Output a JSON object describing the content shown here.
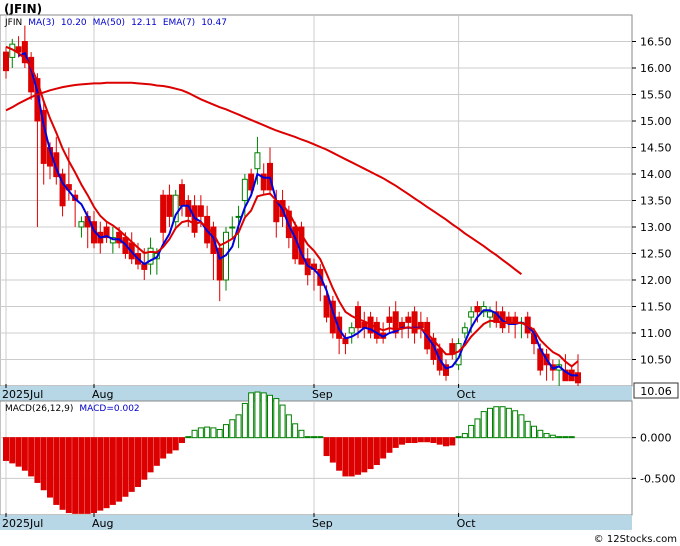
{
  "title": "(JFIN)",
  "watermark": "© 12Stocks.com",
  "price_panel": {
    "legend": [
      {
        "text": "JFIN",
        "color": "#000000"
      },
      {
        "text": "MA(3)",
        "color": "#0000cc"
      },
      {
        "text": "10.20",
        "color": "#0000cc"
      },
      {
        "text": "MA(50)",
        "color": "#0000cc"
      },
      {
        "text": "12.11",
        "color": "#0000cc"
      },
      {
        "text": "EMA(7)",
        "color": "#0000cc"
      },
      {
        "text": "10.47",
        "color": "#0000cc"
      }
    ],
    "last_price_label": "10.06"
  },
  "macd_panel": {
    "legend": [
      {
        "text": "MACD(26,12,9)",
        "color": "#000000"
      },
      {
        "text": "MACD=0.002",
        "color": "#0000cc"
      }
    ]
  },
  "colors": {
    "up": "#008000",
    "down": "#dd0000",
    "ma3": "#0000dd",
    "ma50": "#dd0000",
    "ema7": "#dd0000",
    "axis_strip": "#b7d7e6",
    "grid": "#cccccc"
  },
  "chart_data": [
    {
      "type": "candlestick",
      "title": "(JFIN)",
      "x_labels": [
        {
          "index": 0,
          "text": "2025Jul"
        },
        {
          "index": 14,
          "text": "Aug"
        },
        {
          "index": 49,
          "text": "Sep"
        },
        {
          "index": 72,
          "text": "Oct"
        }
      ],
      "yticks": [
        "16.50",
        "16.00",
        "15.50",
        "15.00",
        "14.50",
        "14.00",
        "13.50",
        "13.00",
        "12.50",
        "12.00",
        "11.50",
        "11.00",
        "10.50"
      ],
      "ylim": [
        10.0,
        17.0
      ],
      "ohlc": [
        [
          16.3,
          16.4,
          15.8,
          15.95
        ],
        [
          16.2,
          16.55,
          16.0,
          16.45
        ],
        [
          16.4,
          16.6,
          16.2,
          16.3
        ],
        [
          16.5,
          16.8,
          16.0,
          16.1
        ],
        [
          16.2,
          16.3,
          15.4,
          15.55
        ],
        [
          15.8,
          15.9,
          13.0,
          15.0
        ],
        [
          15.2,
          15.4,
          13.8,
          14.2
        ],
        [
          14.5,
          14.6,
          13.9,
          14.15
        ],
        [
          14.4,
          14.7,
          13.8,
          13.95
        ],
        [
          14.0,
          14.1,
          13.2,
          13.4
        ],
        [
          13.8,
          14.5,
          13.5,
          13.7
        ],
        [
          13.6,
          13.7,
          13.0,
          13.5
        ],
        [
          13.0,
          13.2,
          12.8,
          13.1
        ],
        [
          13.2,
          13.3,
          12.6,
          13.0
        ],
        [
          13.1,
          13.3,
          12.6,
          12.7
        ],
        [
          12.9,
          13.1,
          12.5,
          12.7
        ],
        [
          13.0,
          13.1,
          12.7,
          12.8
        ],
        [
          12.7,
          13.0,
          12.5,
          12.8
        ],
        [
          12.9,
          13.0,
          12.6,
          12.7
        ],
        [
          12.8,
          12.9,
          12.4,
          12.5
        ],
        [
          12.7,
          12.9,
          12.3,
          12.4
        ],
        [
          12.5,
          12.7,
          12.2,
          12.3
        ],
        [
          12.3,
          12.6,
          12.0,
          12.2
        ],
        [
          12.3,
          12.8,
          12.1,
          12.6
        ],
        [
          12.4,
          12.6,
          12.1,
          12.5
        ],
        [
          13.6,
          13.7,
          12.7,
          12.9
        ],
        [
          13.6,
          13.8,
          13.0,
          13.2
        ],
        [
          13.1,
          13.7,
          13.0,
          13.6
        ],
        [
          13.8,
          13.9,
          13.2,
          13.4
        ],
        [
          13.5,
          13.6,
          13.0,
          13.2
        ],
        [
          13.4,
          13.6,
          12.8,
          12.9
        ],
        [
          13.4,
          13.6,
          13.0,
          13.2
        ],
        [
          13.2,
          13.4,
          12.6,
          12.7
        ],
        [
          13.0,
          13.1,
          12.0,
          12.5
        ],
        [
          12.6,
          12.7,
          11.6,
          12.0
        ],
        [
          12.0,
          13.0,
          11.8,
          12.9
        ],
        [
          13.0,
          13.2,
          12.8,
          13.0
        ],
        [
          13.2,
          13.4,
          12.6,
          13.2
        ],
        [
          13.5,
          14.0,
          13.2,
          13.9
        ],
        [
          14.0,
          14.1,
          13.6,
          13.7
        ],
        [
          14.1,
          14.7,
          13.8,
          14.4
        ],
        [
          14.0,
          14.2,
          13.6,
          13.7
        ],
        [
          14.2,
          14.5,
          13.6,
          13.7
        ],
        [
          13.5,
          13.7,
          12.8,
          13.1
        ],
        [
          13.5,
          13.7,
          13.0,
          13.2
        ],
        [
          13.3,
          13.4,
          12.6,
          12.8
        ],
        [
          13.0,
          13.1,
          12.3,
          12.4
        ],
        [
          13.0,
          13.1,
          12.3,
          12.3
        ],
        [
          12.4,
          12.6,
          11.9,
          12.1
        ],
        [
          12.3,
          12.4,
          11.8,
          12.2
        ],
        [
          12.2,
          12.3,
          11.6,
          11.9
        ],
        [
          11.7,
          11.9,
          11.2,
          11.3
        ],
        [
          11.6,
          11.7,
          10.9,
          11.0
        ],
        [
          11.3,
          11.4,
          10.6,
          10.9
        ],
        [
          10.9,
          11.0,
          10.6,
          10.8
        ],
        [
          11.0,
          11.2,
          10.8,
          11.1
        ],
        [
          11.5,
          11.6,
          10.9,
          11.1
        ],
        [
          11.2,
          11.4,
          10.9,
          11.1
        ],
        [
          11.3,
          11.4,
          10.9,
          11.0
        ],
        [
          11.2,
          11.3,
          10.8,
          10.9
        ],
        [
          11.0,
          11.2,
          10.8,
          10.9
        ],
        [
          11.3,
          11.5,
          11.0,
          11.2
        ],
        [
          11.4,
          11.6,
          10.9,
          11.0
        ],
        [
          11.2,
          11.3,
          10.9,
          11.1
        ],
        [
          11.3,
          11.4,
          10.9,
          11.2
        ],
        [
          11.4,
          11.5,
          10.8,
          11.0
        ],
        [
          11.2,
          11.4,
          10.9,
          11.1
        ],
        [
          11.2,
          11.3,
          10.6,
          10.7
        ],
        [
          10.9,
          11.0,
          10.4,
          10.5
        ],
        [
          10.7,
          10.8,
          10.2,
          10.3
        ],
        [
          10.4,
          10.5,
          10.1,
          10.2
        ],
        [
          10.8,
          10.9,
          10.5,
          10.6
        ],
        [
          10.4,
          10.9,
          10.3,
          10.8
        ],
        [
          11.0,
          11.2,
          10.9,
          11.1
        ],
        [
          11.3,
          11.5,
          11.0,
          11.4
        ],
        [
          11.5,
          11.6,
          11.2,
          11.4
        ],
        [
          11.4,
          11.6,
          11.3,
          11.5
        ],
        [
          11.3,
          11.5,
          11.1,
          11.4
        ],
        [
          11.4,
          11.6,
          11.1,
          11.2
        ],
        [
          11.4,
          11.5,
          11.0,
          11.1
        ],
        [
          11.3,
          11.4,
          11.0,
          11.2
        ],
        [
          11.3,
          11.4,
          10.9,
          11.2
        ],
        [
          11.2,
          11.3,
          10.9,
          11.2
        ],
        [
          11.3,
          11.4,
          10.9,
          11.0
        ],
        [
          11.0,
          11.1,
          10.6,
          10.8
        ],
        [
          10.7,
          10.8,
          10.2,
          10.3
        ],
        [
          10.6,
          10.7,
          10.1,
          10.4
        ],
        [
          10.4,
          10.5,
          10.1,
          10.3
        ],
        [
          10.3,
          10.5,
          10.0,
          10.4
        ],
        [
          10.3,
          10.6,
          10.1,
          10.1
        ],
        [
          10.3,
          10.4,
          10.1,
          10.1
        ],
        [
          10.25,
          10.6,
          10.0,
          10.06
        ]
      ],
      "series": [
        {
          "name": "MA(3)",
          "values": [
            null,
            null,
            16.23,
            16.28,
            15.98,
            15.55,
            14.92,
            14.45,
            14.1,
            13.83,
            13.68,
            13.53,
            13.43,
            13.2,
            12.93,
            12.8,
            12.83,
            12.77,
            12.77,
            12.67,
            12.53,
            12.4,
            12.3,
            12.37,
            12.43,
            12.67,
            12.87,
            13.23,
            13.4,
            13.4,
            13.17,
            13.1,
            12.93,
            12.8,
            12.4,
            12.47,
            12.63,
            13.03,
            13.37,
            13.6,
            14.0,
            13.93,
            13.93,
            13.5,
            13.33,
            13.03,
            12.8,
            12.5,
            12.27,
            12.2,
            12.07,
            11.8,
            11.4,
            11.07,
            10.9,
            10.93,
            11.0,
            11.1,
            11.07,
            11.0,
            10.93,
            11.0,
            11.03,
            11.1,
            11.1,
            11.1,
            11.1,
            10.93,
            10.77,
            10.5,
            10.33,
            10.37,
            10.53,
            10.83,
            11.1,
            11.3,
            11.43,
            11.43,
            11.37,
            11.23,
            11.17,
            11.17,
            11.2,
            11.13,
            11.0,
            10.7,
            10.5,
            10.33,
            10.37,
            10.27,
            10.2,
            10.2
          ]
        },
        {
          "name": "EMA(7)",
          "values": [
            16.4,
            16.35,
            16.28,
            16.18,
            16.02,
            15.75,
            15.37,
            15.05,
            14.78,
            14.48,
            14.24,
            14.03,
            13.8,
            13.6,
            13.38,
            13.21,
            13.1,
            13.03,
            12.94,
            12.83,
            12.72,
            12.61,
            12.51,
            12.53,
            12.52,
            12.62,
            12.77,
            12.98,
            13.09,
            13.12,
            13.06,
            13.09,
            12.99,
            12.87,
            12.65,
            12.71,
            12.78,
            12.9,
            13.18,
            13.31,
            13.58,
            13.61,
            13.63,
            13.5,
            13.42,
            13.27,
            13.05,
            12.86,
            12.67,
            12.55,
            12.39,
            12.12,
            11.84,
            11.6,
            11.4,
            11.32,
            11.26,
            11.22,
            11.16,
            11.1,
            11.05,
            11.09,
            11.07,
            11.08,
            11.11,
            11.08,
            11.09,
            10.99,
            10.87,
            10.73,
            10.6,
            10.6,
            10.65,
            10.77,
            10.93,
            11.05,
            11.17,
            11.23,
            11.22,
            11.19,
            11.19,
            11.19,
            11.19,
            11.14,
            11.06,
            10.87,
            10.75,
            10.64,
            10.58,
            10.46,
            10.37,
            10.47
          ]
        },
        {
          "name": "MA(50)",
          "values": [
            15.2,
            15.26,
            15.33,
            15.39,
            15.45,
            15.5,
            15.54,
            15.58,
            15.61,
            15.64,
            15.66,
            15.68,
            15.69,
            15.7,
            15.71,
            15.71,
            15.72,
            15.72,
            15.72,
            15.72,
            15.72,
            15.71,
            15.7,
            15.69,
            15.67,
            15.66,
            15.64,
            15.61,
            15.58,
            15.53,
            15.47,
            15.41,
            15.36,
            15.31,
            15.26,
            15.22,
            15.17,
            15.12,
            15.07,
            15.02,
            14.97,
            14.92,
            14.87,
            14.82,
            14.78,
            14.74,
            14.7,
            14.65,
            14.61,
            14.56,
            14.51,
            14.46,
            14.4,
            14.34,
            14.28,
            14.22,
            14.16,
            14.1,
            14.04,
            13.98,
            13.92,
            13.85,
            13.78,
            13.7,
            13.62,
            13.54,
            13.46,
            13.38,
            13.3,
            13.22,
            13.14,
            13.05,
            12.97,
            12.88,
            12.8,
            12.72,
            12.64,
            12.55,
            12.47,
            12.38,
            12.29,
            12.2,
            12.11
          ]
        }
      ]
    },
    {
      "type": "bar",
      "title": "MACD(26,12,9)",
      "x_labels": [
        {
          "index": 0,
          "text": "2025Jul"
        },
        {
          "index": 14,
          "text": "Aug"
        },
        {
          "index": 49,
          "text": "Sep"
        },
        {
          "index": 72,
          "text": "Oct"
        }
      ],
      "yticks": [
        "0.000",
        "-0.500"
      ],
      "ylim": [
        -0.95,
        0.45
      ],
      "values": [
        -0.28,
        -0.31,
        -0.35,
        -0.4,
        -0.47,
        -0.55,
        -0.64,
        -0.73,
        -0.82,
        -0.88,
        -0.92,
        -0.93,
        -0.93,
        -0.93,
        -0.92,
        -0.89,
        -0.86,
        -0.82,
        -0.78,
        -0.72,
        -0.66,
        -0.6,
        -0.51,
        -0.42,
        -0.34,
        -0.25,
        -0.19,
        -0.15,
        -0.06,
        0.0,
        0.09,
        0.12,
        0.13,
        0.12,
        0.1,
        0.16,
        0.22,
        0.28,
        0.42,
        0.55,
        0.56,
        0.55,
        0.52,
        0.48,
        0.4,
        0.28,
        0.17,
        0.09,
        0.01,
        0.0,
        0.0,
        -0.22,
        -0.3,
        -0.4,
        -0.47,
        -0.47,
        -0.45,
        -0.42,
        -0.38,
        -0.33,
        -0.25,
        -0.18,
        -0.12,
        -0.08,
        -0.06,
        -0.06,
        -0.05,
        -0.05,
        -0.06,
        -0.08,
        -0.1,
        -0.09,
        0.0,
        0.05,
        0.15,
        0.23,
        0.32,
        0.36,
        0.38,
        0.38,
        0.36,
        0.33,
        0.28,
        0.2,
        0.14,
        0.09,
        0.05,
        0.03,
        0.01,
        0.01,
        0.002
      ]
    }
  ]
}
